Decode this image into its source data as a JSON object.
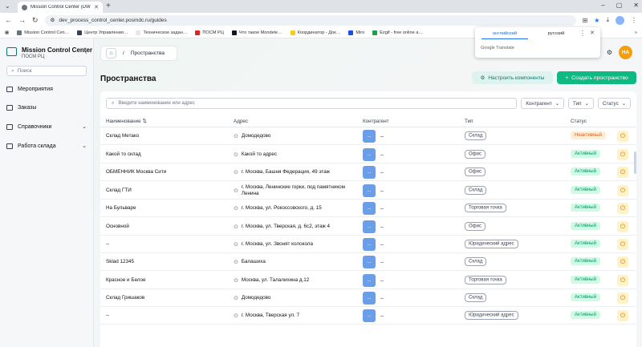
{
  "browser": {
    "tab_title": "Mission Control Center (DWS)",
    "url": "dev_process_control_center.posmdc.ru/guides",
    "bookmarks": [
      {
        "label": "Mission Control Cen…",
        "color": "#6b7280"
      },
      {
        "label": "Центр Управления…",
        "color": "#374151"
      },
      {
        "label": "Техническое задан…",
        "color": "#e5e7eb"
      },
      {
        "label": "ПОСМ РЦ",
        "color": "#dc2626"
      },
      {
        "label": "Что такое Mondele…",
        "color": "#111827"
      },
      {
        "label": "Координатор - Док…",
        "color": "#facc15"
      },
      {
        "label": "Miro",
        "color": "#1d4ed8"
      },
      {
        "label": "Ezgif - free online a…",
        "color": "#16a34a"
      }
    ],
    "all_bookmarks_label": "»"
  },
  "translate_popup": {
    "lang_from": "английский",
    "lang_to": "русский",
    "provider": "Google Translate"
  },
  "sidebar": {
    "brand_name": "Mission Control Center",
    "brand_sub": "ПОСМ РЦ",
    "search_placeholder": "Поиск",
    "items": [
      {
        "label": "Мероприятия",
        "has_chevron": false
      },
      {
        "label": "Заказы",
        "has_chevron": false
      },
      {
        "label": "Справочники",
        "has_chevron": true
      },
      {
        "label": "Работа склада",
        "has_chevron": true
      }
    ]
  },
  "header": {
    "breadcrumb_sep": "/",
    "breadcrumb_current": "Пространства",
    "avatar_initials": "НА"
  },
  "page": {
    "title": "Пространства",
    "configure_label": "Настроить компоненты",
    "create_label": "Создать пространство"
  },
  "filters": {
    "search_placeholder": "Введите наименование или адрес",
    "contractor": "Контрагент",
    "type": "Тип",
    "status": "Статус"
  },
  "table": {
    "columns": [
      "Наименование",
      "Адрес",
      "Контрагент",
      "Тип",
      "Статус"
    ],
    "contractor_btn": "...",
    "contractor_dash": "--",
    "rows": [
      {
        "name": "Склад Метако",
        "address": "Домодедово",
        "type": "Склад",
        "status": "Неактивный",
        "active": false
      },
      {
        "name": "Какой то склад",
        "address": "Какой то адрес",
        "type": "Офис",
        "status": "Активный",
        "active": true
      },
      {
        "name": "ОБМЕННИК Москва Сити",
        "address": "г. Москва, Башня Федерация, 49 этаж",
        "type": "Офис",
        "status": "Активный",
        "active": true
      },
      {
        "name": "Склад ГТИ",
        "address": "г. Москва, Ленинские горки, под памятником Ленина",
        "type": "Склад",
        "status": "Активный",
        "active": true
      },
      {
        "name": "На Бульваре",
        "address": "г. Москва, ул. Рокоссовского, д. 15",
        "type": "Торговая точка",
        "status": "Активный",
        "active": true
      },
      {
        "name": "Основной",
        "address": "г. Москва, ул. Тверская, д. 6с2, этаж 4",
        "type": "Офис",
        "status": "Активный",
        "active": true
      },
      {
        "name": "--",
        "address": "г. Москва, ул. Звонят колокола",
        "type": "Юридический адрес",
        "status": "Активный",
        "active": true
      },
      {
        "name": "Sklad 12345",
        "address": "Балашиха",
        "type": "Склад",
        "status": "Активный",
        "active": true
      },
      {
        "name": "Красное и Белое",
        "address": "Москва, ул. Талалихина д.12",
        "type": "Торговая точка",
        "status": "Активный",
        "active": true
      },
      {
        "name": "Склад Гришаков",
        "address": "Домодедово",
        "type": "Склад",
        "status": "Активный",
        "active": true
      },
      {
        "name": "--",
        "address": "г. Москва, Тверская ул. 7",
        "type": "Юридический адрес",
        "status": "Активный",
        "active": true
      }
    ]
  }
}
